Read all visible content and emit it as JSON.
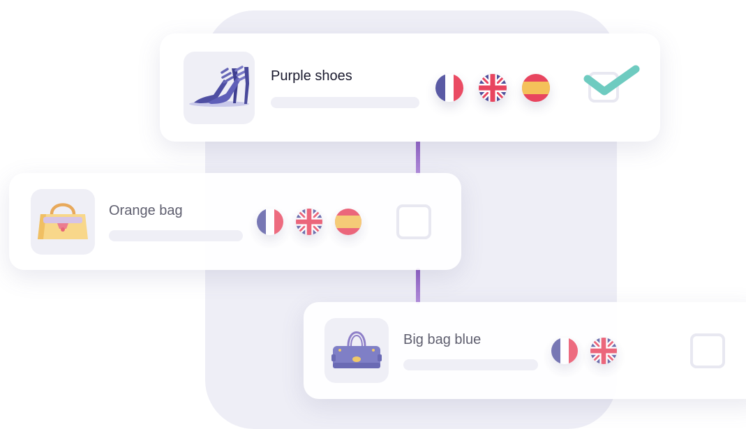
{
  "products": [
    {
      "name": "Purple shoes",
      "image_icon": "high-heel-shoes-icon",
      "flags": [
        "flag-france-icon",
        "flag-uk-icon",
        "flag-spain-icon"
      ],
      "checked": true
    },
    {
      "name": "Orange bag",
      "image_icon": "handbag-icon",
      "flags": [
        "flag-france-icon",
        "flag-uk-icon",
        "flag-spain-icon"
      ],
      "checked": false
    },
    {
      "name": "Big bag blue",
      "image_icon": "duffel-bag-icon",
      "flags": [
        "flag-france-icon",
        "flag-uk-icon"
      ],
      "checked": false
    }
  ],
  "colors": {
    "check_teal": "#6ecbc0",
    "connector_purple": "#8a5cc0",
    "france_blue": "#5a5aa4",
    "france_red": "#ea4b63",
    "spain_yellow": "#f4c15a",
    "uk_blue": "#4f4f9a",
    "uk_red": "#e8455f"
  }
}
